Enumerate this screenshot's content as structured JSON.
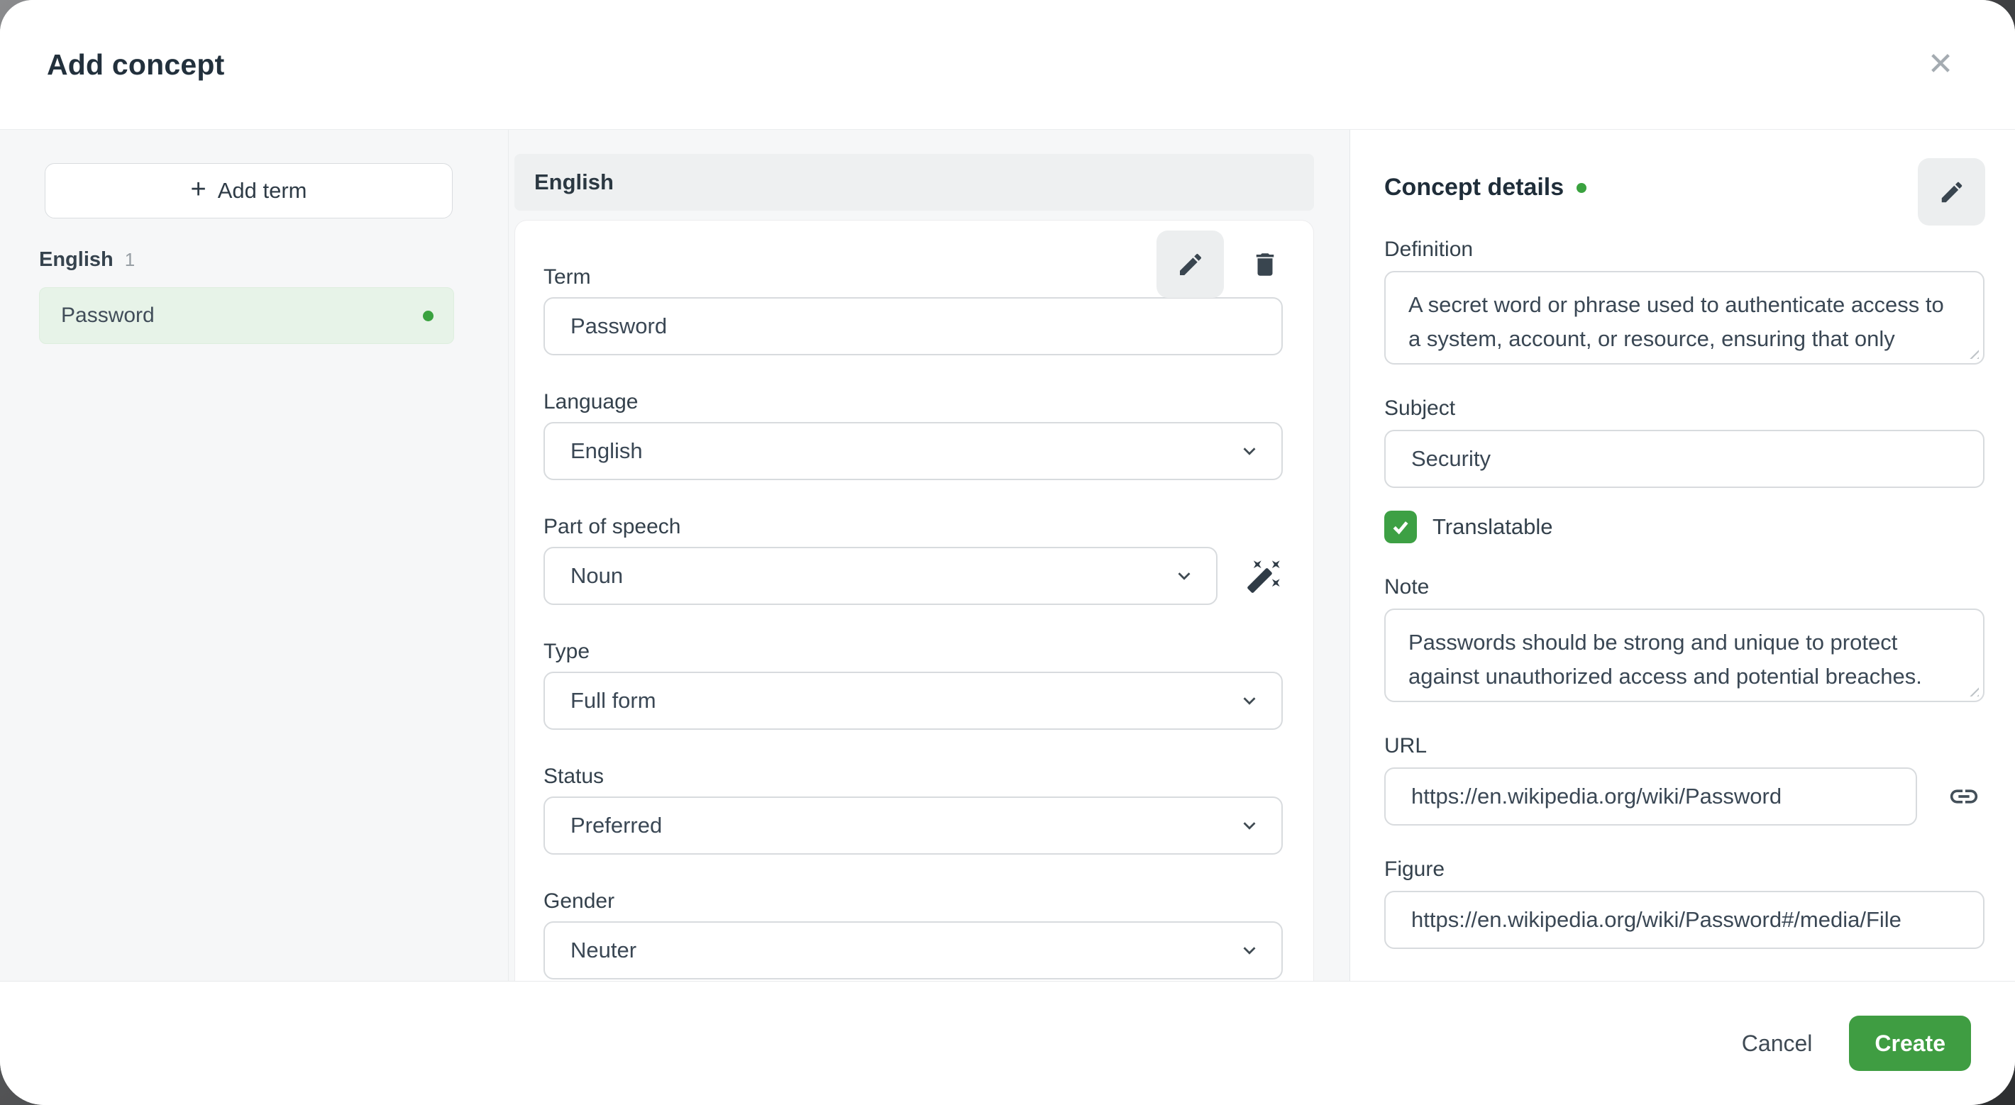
{
  "dialog": {
    "title": "Add concept"
  },
  "icons": {
    "close": "✕",
    "plus": "+"
  },
  "sidebar": {
    "add_term_label": "Add term",
    "group_label": "English",
    "group_count": "1",
    "terms": [
      {
        "label": "Password",
        "status_dot": "green"
      }
    ]
  },
  "term_panel": {
    "header": "English",
    "fields": {
      "term": {
        "label": "Term",
        "value": "Password"
      },
      "language": {
        "label": "Language",
        "value": "English"
      },
      "part_of_speech": {
        "label": "Part of speech",
        "value": "Noun"
      },
      "type": {
        "label": "Type",
        "value": "Full form"
      },
      "status": {
        "label": "Status",
        "value": "Preferred"
      },
      "gender": {
        "label": "Gender",
        "value": "Neuter"
      }
    }
  },
  "concept_details": {
    "title": "Concept details",
    "status_dot": "green",
    "definition": {
      "label": "Definition",
      "value": "A secret word or phrase used to authenticate access to a system, account, or resource, ensuring that only authorized users can gain access."
    },
    "subject": {
      "label": "Subject",
      "value": "Security"
    },
    "translatable": {
      "label": "Translatable",
      "checked": true
    },
    "note": {
      "label": "Note",
      "value": "Passwords should be strong and unique to protect against unauthorized access and potential breaches."
    },
    "url": {
      "label": "URL",
      "value": "https://en.wikipedia.org/wiki/Password"
    },
    "figure": {
      "label": "Figure",
      "value": "https://en.wikipedia.org/wiki/Password#/media/File"
    }
  },
  "footer": {
    "cancel_label": "Cancel",
    "create_label": "Create"
  },
  "colors": {
    "accent_green": "#3f9d42",
    "checkbox_green": "#3da044",
    "dot_green": "#3aa23f",
    "term_highlight_bg": "#e7f3e8",
    "panel_gray": "#f6f7f8",
    "bar_gray": "#eef0f1",
    "text_dark": "#22303c",
    "border_gray": "#d8dbde"
  }
}
